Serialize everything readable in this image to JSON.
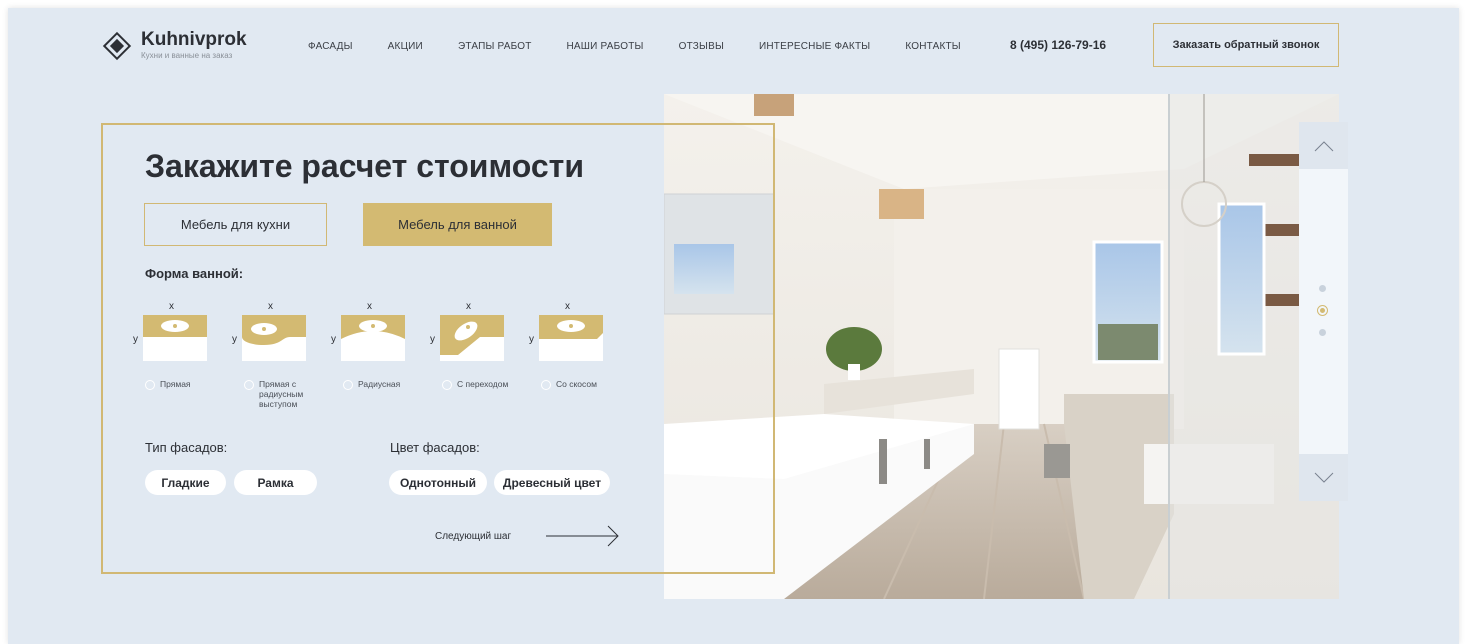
{
  "header": {
    "logo_title": "Kuhnivprok",
    "logo_subtitle": "Кухни и ванные на заказ",
    "nav": [
      "ФАСАДЫ",
      "АКЦИИ",
      "ЭТАПЫ РАБОТ",
      "НАШИ РАБОТЫ",
      "ОТЗЫВЫ",
      "ИНТЕРЕСНЫЕ ФАКТЫ",
      "КОНТАКТЫ"
    ],
    "phone": "8 (495) 126-79-16",
    "callback_label": "Заказать обратный звонок"
  },
  "form": {
    "title": "Закажите расчет стоимости",
    "tabs": [
      "Мебель для кухни",
      "Мебель для ванной"
    ],
    "active_tab": "Мебель для ванной",
    "shape_label": "Форма ванной:",
    "axis_x": "x",
    "axis_y": "y",
    "shapes": [
      {
        "label": "Прямая",
        "icon": "straight-bath-icon"
      },
      {
        "label": "Прямая с радиусным выступом",
        "icon": "radius-protrusion-bath-icon"
      },
      {
        "label": "Радиусная",
        "icon": "radius-bath-icon"
      },
      {
        "label": "С переходом",
        "icon": "transition-bath-icon"
      },
      {
        "label": "Со скосом",
        "icon": "bevel-bath-icon"
      }
    ],
    "facade_type_label": "Тип фасадов:",
    "facade_types": [
      "Гладкие",
      "Рамка"
    ],
    "facade_color_label": "Цвет фасадов:",
    "facade_colors": [
      "Однотонный",
      "Древесный цвет"
    ],
    "next_label": "Следующий шаг"
  },
  "slider": {
    "dots": 3,
    "active_dot": 2
  },
  "colors": {
    "accent": "#d3ba72",
    "background": "#e1e9f2",
    "text": "#2c2f35"
  }
}
